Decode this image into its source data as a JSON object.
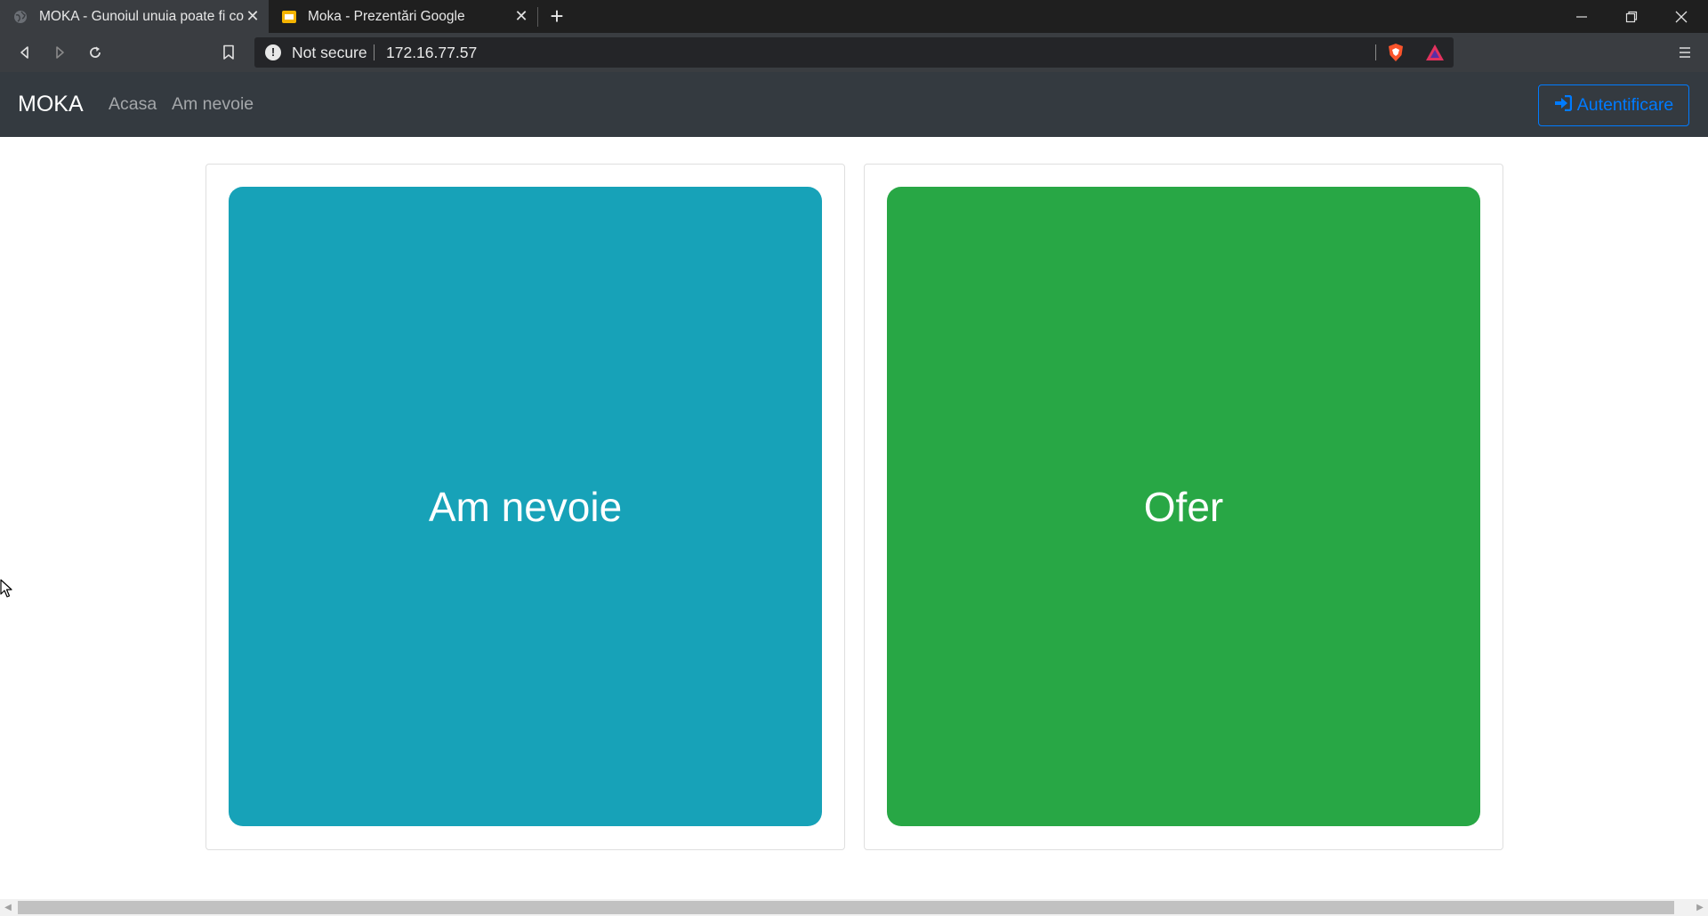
{
  "browser": {
    "tabs": [
      {
        "title": "MOKA - Gunoiul unuia poate fi comoara altuia",
        "active": true,
        "favicon": "globe-icon"
      },
      {
        "title": "Moka - Prezentări Google",
        "active": false,
        "favicon": "google-slides-icon"
      }
    ],
    "security_label": "Not secure",
    "url": "172.16.77.57"
  },
  "site": {
    "brand": "MOKA",
    "nav": [
      {
        "label": "Acasa"
      },
      {
        "label": "Am nevoie"
      }
    ],
    "login_label": "Autentificare",
    "login_icon": "sign-in-icon"
  },
  "main": {
    "choices": [
      {
        "label": "Am nevoie",
        "color": "#17a2b8"
      },
      {
        "label": "Ofer",
        "color": "#28a745"
      }
    ]
  },
  "colors": {
    "navbar": "#343a40",
    "primary": "#007bff",
    "info": "#17a2b8",
    "success": "#28a745"
  }
}
